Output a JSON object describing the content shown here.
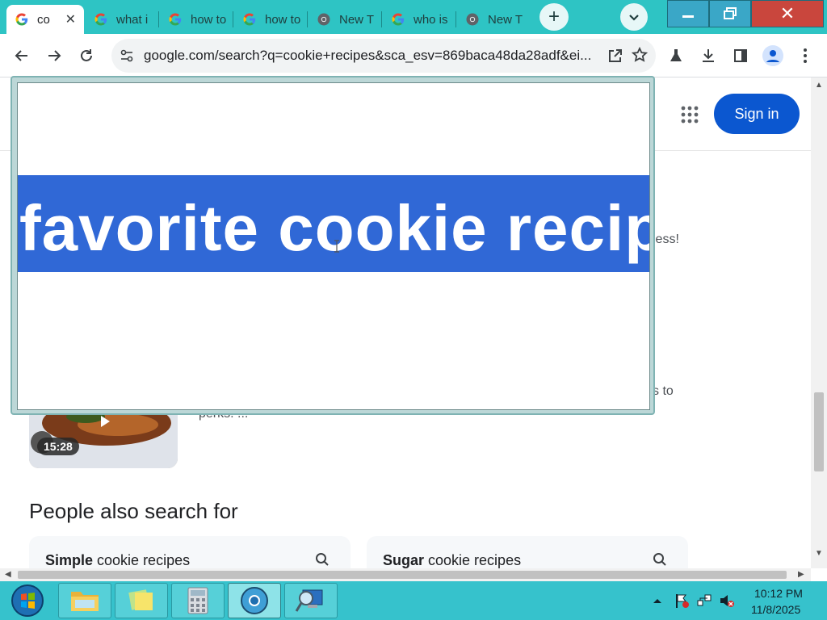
{
  "browser": {
    "tabs": [
      {
        "title": "co",
        "active": true
      },
      {
        "title": "what i",
        "active": false
      },
      {
        "title": "how to",
        "active": false
      },
      {
        "title": "how to",
        "active": false
      },
      {
        "title": "New T",
        "active": false
      },
      {
        "title": "who is",
        "active": false
      },
      {
        "title": "New T",
        "active": false
      }
    ],
    "url": "google.com/search?q=cookie+recipes&sca_esv=869baca48da28adf&ei...",
    "accent": "#2ec4c4"
  },
  "page": {
    "sign_in_label": "Sign in",
    "snippet_right_1": "less!",
    "snippet_right_2": "s to",
    "snippet_3": "perks. ...",
    "video_duration": "15:28",
    "people_also_search_heading": "People also search for",
    "people_also_search": [
      {
        "bold": "Simple",
        "rest": " cookie recipes"
      },
      {
        "bold": "Sugar",
        "rest": " cookie recipes"
      }
    ],
    "sign_in_color": "#0b57d0"
  },
  "magnifier": {
    "text": "favorite cookie recipe,",
    "highlight_color": "#3068d6"
  },
  "taskbar": {
    "time": "10:12 PM",
    "date": "11/8/2025"
  }
}
